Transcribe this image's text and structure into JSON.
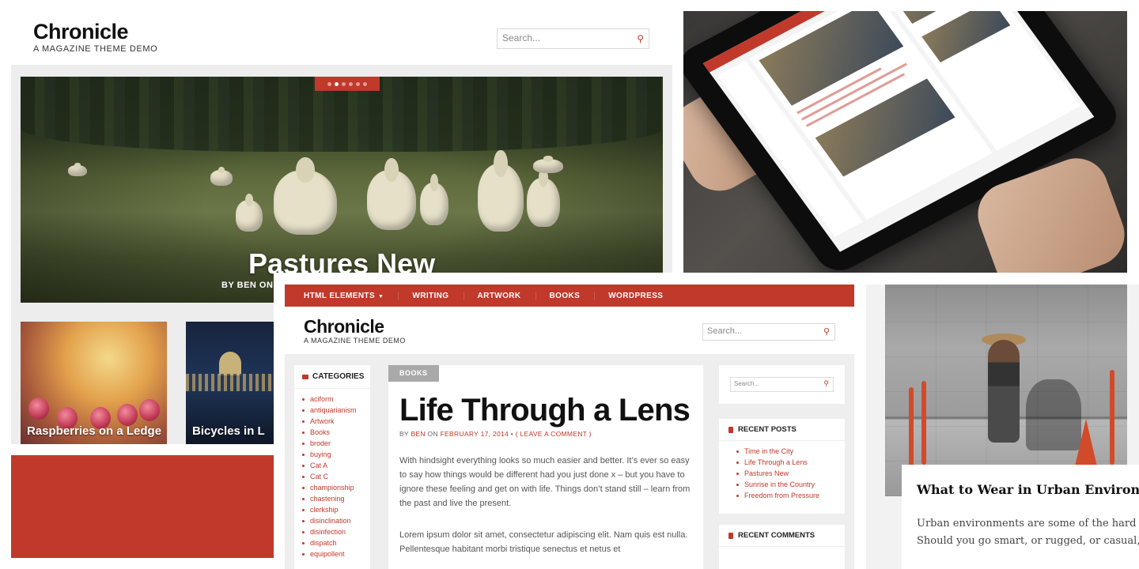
{
  "theme": {
    "accent": "#c0392b",
    "light_bg": "#eeeeee"
  },
  "desktop_preview": {
    "site_title": "Chronicle",
    "tagline": "A MAGAZINE THEME DEMO",
    "search_placeholder": "Search...",
    "slider_dots": 6,
    "slider_active_dot": 1,
    "hero_title": "Pastures New",
    "hero_byline": "BY BEN ON",
    "thumbs": [
      {
        "title": "Raspberries on a Ledge"
      },
      {
        "title": "Bicycles in L"
      }
    ]
  },
  "main_page": {
    "nav": [
      {
        "label": "HTML ELEMENTS",
        "has_dropdown": true
      },
      {
        "label": "WRITING"
      },
      {
        "label": "ARTWORK"
      },
      {
        "label": "BOOKS"
      },
      {
        "label": "WORDPRESS"
      }
    ],
    "site_title": "Chronicle",
    "tagline": "A MAGAZINE THEME DEMO",
    "search_placeholder": "Search...",
    "categories": {
      "heading": "CATEGORIES",
      "items": [
        "aciform",
        "antiquarianism",
        "Artwork",
        "Books",
        "broder",
        "buying",
        "Cat A",
        "Cat C",
        "championship",
        "chastening",
        "clerkship",
        "disinclination",
        "disinfection",
        "dispatch",
        "equipollent"
      ]
    },
    "article": {
      "category_badge": "BOOKS",
      "title": "Life Through a Lens",
      "meta_by": "BY",
      "meta_author": "BEN",
      "meta_on": "ON",
      "meta_date": "FEBRUARY 17, 2014",
      "meta_sep": "•",
      "meta_comment": "( LEAVE A COMMENT )",
      "paragraph_1": "With hindsight everything looks so much easier and better. It’s ever so easy to say how things would be different had you just done x – but you have to ignore these feeling and get on with life. Things don’t stand still – learn from the past and live the present.",
      "paragraph_2": "Lorem ipsum dolor sit amet, consectetur adipiscing elit. Nam quis est nulla. Pellentesque habitant morbi tristique senectus et netus et"
    },
    "sidebar": {
      "search_placeholder": "Search...",
      "recent_posts": {
        "heading": "RECENT POSTS",
        "items": [
          "Time in the City",
          "Life Through a Lens",
          "Pastures New",
          "Sunrise in the Country",
          "Freedom from Pressure"
        ]
      },
      "recent_comments": {
        "heading": "RECENT COMMENTS"
      }
    }
  },
  "right_preview": {
    "title": "What to Wear in Urban Environn",
    "line_1": "Urban environments are some of the hard",
    "line_2": "Should you go smart, or rugged, or casual,"
  }
}
